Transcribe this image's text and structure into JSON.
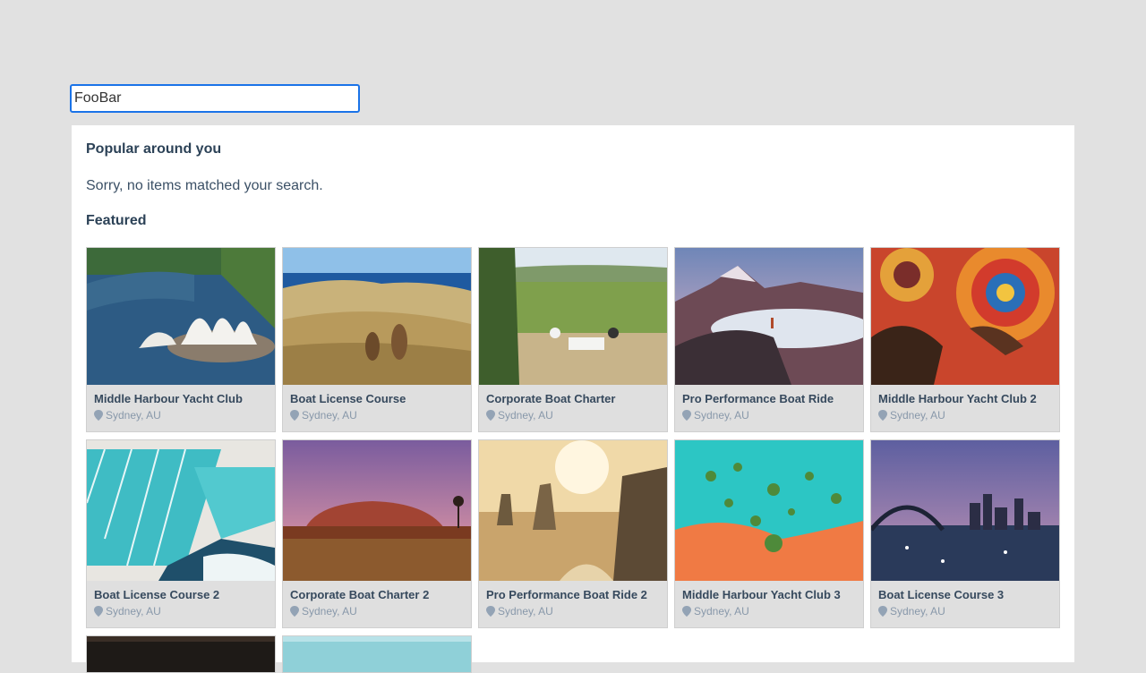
{
  "search": {
    "value": "FooBar"
  },
  "panel": {
    "popular_heading": "Popular around you",
    "no_results": "Sorry, no items matched your search.",
    "featured_heading": "Featured"
  },
  "cards": [
    {
      "title": "Middle Harbour Yacht Club",
      "location": "Sydney, AU",
      "image": "opera-house"
    },
    {
      "title": "Boat License Course",
      "location": "Sydney, AU",
      "image": "kangaroos"
    },
    {
      "title": "Corporate Boat Charter",
      "location": "Sydney, AU",
      "image": "vineyard"
    },
    {
      "title": "Pro Performance Boat Ride",
      "location": "Sydney, AU",
      "image": "mountain"
    },
    {
      "title": "Middle Harbour Yacht Club 2",
      "location": "Sydney, AU",
      "image": "aboriginal-art"
    },
    {
      "title": "Boat License Course 2",
      "location": "Sydney, AU",
      "image": "ocean-pool"
    },
    {
      "title": "Corporate Boat Charter 2",
      "location": "Sydney, AU",
      "image": "uluru"
    },
    {
      "title": "Pro Performance Boat Ride 2",
      "location": "Sydney, AU",
      "image": "twelve-apostles"
    },
    {
      "title": "Middle Harbour Yacht Club 3",
      "location": "Sydney, AU",
      "image": "reef-aerial"
    },
    {
      "title": "Boat License Course 3",
      "location": "Sydney, AU",
      "image": "harbour-bridge"
    }
  ],
  "pin_icon": "location-pin-icon"
}
